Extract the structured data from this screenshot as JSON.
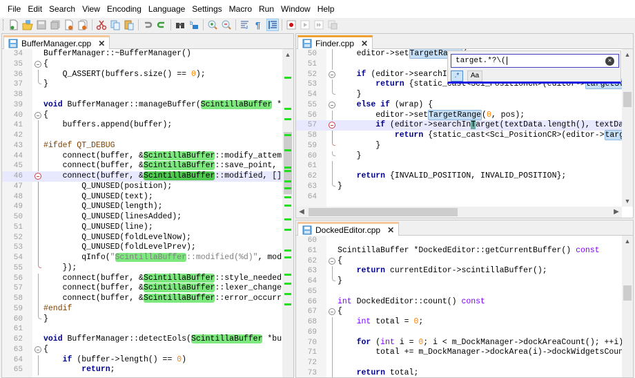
{
  "menu": [
    "File",
    "Edit",
    "Search",
    "View",
    "Encoding",
    "Language",
    "Settings",
    "Macro",
    "Run",
    "Window",
    "Help"
  ],
  "toolbar": {
    "groups": [
      [
        "new-file",
        "open-file",
        "save-file",
        "save-all",
        "close-file",
        "close-all"
      ],
      [
        "cut",
        "copy",
        "paste"
      ],
      [
        "undo",
        "redo"
      ],
      [
        "find",
        "replace"
      ],
      [
        "zoom-in",
        "zoom-out"
      ],
      [
        "word-wrap",
        "show-all-characters",
        "indent-guide"
      ],
      [
        "macro-record",
        "macro-stop",
        "macro-play",
        "macro-run-multiple",
        "macro-save"
      ]
    ],
    "active": "indent-guide"
  },
  "panes": {
    "left": {
      "tab": {
        "label": "BufferManager.cpp",
        "close": "✕"
      },
      "lines": [
        {
          "n": "34",
          "code": "BufferManager::~BufferManager()"
        },
        {
          "n": "35",
          "code": "{"
        },
        {
          "n": "36",
          "code": "    Q_ASSERT(buffers.size() == 0);"
        },
        {
          "n": "37",
          "code": "}"
        },
        {
          "n": "38",
          "code": ""
        },
        {
          "n": "39",
          "code": "void BufferManager::manageBuffer(ScintillaBuffer *b"
        },
        {
          "n": "40",
          "code": "{"
        },
        {
          "n": "41",
          "code": "    buffers.append(buffer);"
        },
        {
          "n": "42",
          "code": ""
        },
        {
          "n": "43",
          "code": "#ifdef QT_DEBUG"
        },
        {
          "n": "44",
          "code": "    connect(buffer, &ScintillaBuffer::modify_attem"
        },
        {
          "n": "45",
          "code": "    connect(buffer, &ScintillaBuffer::save_point,"
        },
        {
          "n": "46",
          "code": "    connect(buffer, &ScintillaBuffer::modified, []"
        },
        {
          "n": "47",
          "code": "        Q_UNUSED(position);"
        },
        {
          "n": "48",
          "code": "        Q_UNUSED(text);"
        },
        {
          "n": "49",
          "code": "        Q_UNUSED(length);"
        },
        {
          "n": "50",
          "code": "        Q_UNUSED(linesAdded);"
        },
        {
          "n": "51",
          "code": "        Q_UNUSED(line);"
        },
        {
          "n": "52",
          "code": "        Q_UNUSED(foldLevelNow);"
        },
        {
          "n": "53",
          "code": "        Q_UNUSED(foldLevelPrev);"
        },
        {
          "n": "54",
          "code": "        qInfo(\"ScintillaBuffer::modified(%d)\", mod"
        },
        {
          "n": "55",
          "code": "    });"
        },
        {
          "n": "56",
          "code": "    connect(buffer, &ScintillaBuffer::style_needed"
        },
        {
          "n": "57",
          "code": "    connect(buffer, &ScintillaBuffer::lexer_change"
        },
        {
          "n": "58",
          "code": "    connect(buffer, &ScintillaBuffer::error_occurr"
        },
        {
          "n": "59",
          "code": "#endif"
        },
        {
          "n": "60",
          "code": "}"
        },
        {
          "n": "61",
          "code": ""
        },
        {
          "n": "62",
          "code": "void BufferManager::detectEols(ScintillaBuffer *bu"
        },
        {
          "n": "63",
          "code": "{"
        },
        {
          "n": "64",
          "code": "    if (buffer->length() == 0)"
        },
        {
          "n": "65",
          "code": "        return;"
        }
      ]
    },
    "top_right": {
      "tab": {
        "label": "Finder.cpp",
        "close": "✕"
      },
      "lines": [
        {
          "n": "50",
          "code": "    editor->setTargetRange(pos, ..."
        },
        {
          "n": "51",
          "code": ""
        },
        {
          "n": "52",
          "code": "    if (editor->searchInTarget(...)"
        },
        {
          "n": "53",
          "code": "        return {static_cast<Sci_PositionCR>(editor->targetSt"
        },
        {
          "n": "54",
          "code": "    }"
        },
        {
          "n": "55",
          "code": "    else if (wrap) {"
        },
        {
          "n": "56",
          "code": "        editor->setTargetRange(0, pos);"
        },
        {
          "n": "57",
          "code": "        if (editor->searchInTarget(textData.length(), textDa"
        },
        {
          "n": "58",
          "code": "            return {static_cast<Sci_PositionCR>(editor->targ"
        },
        {
          "n": "59",
          "code": "        }"
        },
        {
          "n": "60",
          "code": "    }"
        },
        {
          "n": "61",
          "code": ""
        },
        {
          "n": "62",
          "code": "    return {INVALID_POSITION, INVALID_POSITION};"
        },
        {
          "n": "63",
          "code": "}"
        },
        {
          "n": "64",
          "code": ""
        }
      ],
      "find": {
        "query": "target.*?\\(",
        "regex_label": ".*",
        "match_case_label": "Aa",
        "clear_icon": "✕"
      }
    },
    "bottom_right": {
      "tab": {
        "label": "DockedEditor.cpp",
        "close": "✕"
      },
      "lines": [
        {
          "n": "60",
          "code": ""
        },
        {
          "n": "61",
          "code": "ScintillaBuffer *DockedEditor::getCurrentBuffer() const"
        },
        {
          "n": "62",
          "code": "{"
        },
        {
          "n": "63",
          "code": "    return currentEditor->scintillaBuffer();"
        },
        {
          "n": "64",
          "code": "}"
        },
        {
          "n": "65",
          "code": ""
        },
        {
          "n": "66",
          "code": "int DockedEditor::count() const"
        },
        {
          "n": "67",
          "code": "{"
        },
        {
          "n": "68",
          "code": "    int total = 0;"
        },
        {
          "n": "69",
          "code": ""
        },
        {
          "n": "70",
          "code": "    for (int i = 0; i < m_DockManager->dockAreaCount(); ++i)"
        },
        {
          "n": "71",
          "code": "        total += m_DockManager->dockArea(i)->dockWidgetsCoun"
        },
        {
          "n": "72",
          "code": ""
        },
        {
          "n": "73",
          "code": "    return total;"
        }
      ]
    }
  },
  "colors": {
    "match_highlight": "#7de87d",
    "current_match": "#4ec84e",
    "target_highlight": "#c4dff5",
    "current_line": "#e8e8ff",
    "active_tab_accent": "#f0a030",
    "find_accent": "#1a1ae0"
  }
}
